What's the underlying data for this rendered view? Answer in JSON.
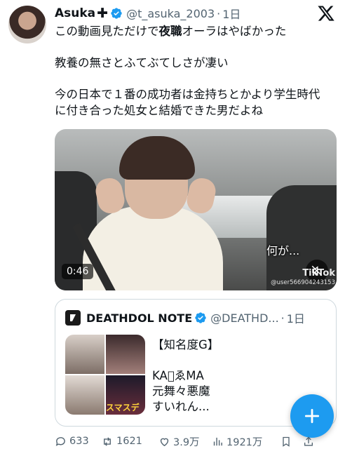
{
  "author": {
    "name": "Asuka",
    "name_symbol": "✚",
    "handle": "@t_asuka_2003",
    "separator": "·",
    "time": "1日",
    "verified_color": "#1d9bf0"
  },
  "tweet": {
    "line1_pre": "この動画見ただけで",
    "line1_bold": "夜職",
    "line1_post": "オーラはやばかった",
    "line2": "教養の無さとふてぶてしさが凄い",
    "line3": "今の日本で１番の成功者は金持ちとかより学生時代",
    "line4": "に付き合った処女と結婚できた男だよね"
  },
  "video": {
    "duration": "0:46",
    "subtitle": "何が...",
    "watermark": "TikTok",
    "watermark_user": "@user566904243153"
  },
  "quote": {
    "name": "DEATHDOL NOTE",
    "handle": "@DEATHD...",
    "separator": "·",
    "time": "1日",
    "grid_caption": "スマスデ",
    "line1": "【知名度G】",
    "line2": "KA゙ゑMA",
    "line3": "元舞々悪魔",
    "line4": "すいれん..."
  },
  "actions": {
    "replies": "633",
    "reposts": "1621",
    "likes": "3.9万",
    "views": "1921万"
  },
  "colors": {
    "accent": "#1d9bf0",
    "text_primary": "#0f1419",
    "text_secondary": "#536471",
    "border": "#cfd9de"
  },
  "icons": [
    "x-logo-icon",
    "verified-badge-icon",
    "volume-mute-icon",
    "plus-icon",
    "reply-icon",
    "repost-icon",
    "like-icon",
    "views-icon",
    "bookmark-icon",
    "share-icon"
  ]
}
